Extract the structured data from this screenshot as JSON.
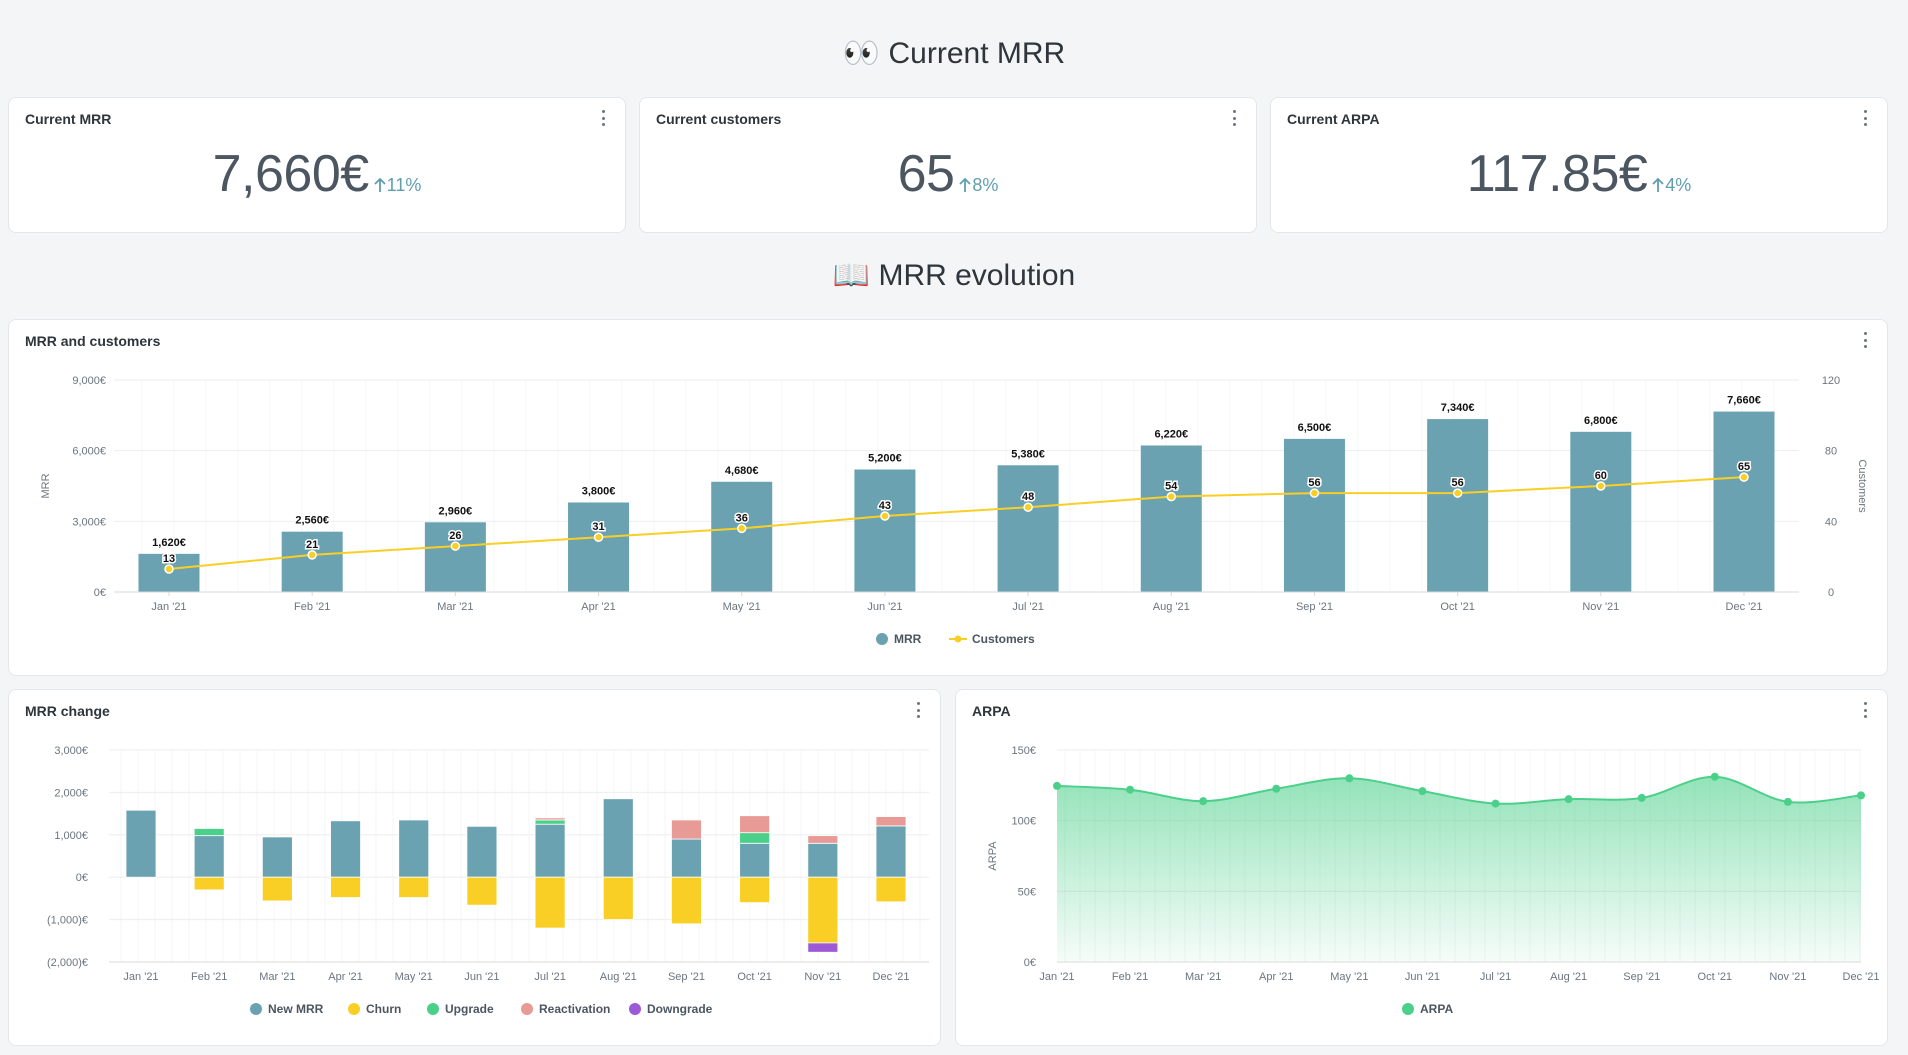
{
  "sections": {
    "current": {
      "icon": "👀",
      "title": "Current MRR"
    },
    "evolution": {
      "icon": "📖",
      "title": "MRR evolution"
    }
  },
  "scalars": [
    {
      "title": "Current MRR",
      "value": "7,660€",
      "change": "11%"
    },
    {
      "title": "Current customers",
      "value": "65",
      "change": "8%"
    },
    {
      "title": "Current ARPA",
      "value": "117.85€",
      "change": "4%"
    }
  ],
  "colors": {
    "mrr": "#6aa2b1",
    "customers": "#f9cf26",
    "new_mrr": "#6aa2b1",
    "churn": "#f9cf26",
    "upgrade": "#4bd08a",
    "reactivation": "#e89a96",
    "downgrade": "#9c5ad6",
    "arpa": "#4bd08a",
    "change_up": "#5f9ead"
  },
  "cards": {
    "mrr_customers": {
      "title": "MRR and customers"
    },
    "mrr_change": {
      "title": "MRR change"
    },
    "arpa": {
      "title": "ARPA"
    }
  },
  "chart_data": [
    {
      "type": "bar",
      "title": "MRR and customers",
      "categories": [
        "Jan '21",
        "Feb '21",
        "Mar '21",
        "Apr '21",
        "May '21",
        "Jun '21",
        "Jul '21",
        "Aug '21",
        "Sep '21",
        "Oct '21",
        "Nov '21",
        "Dec '21"
      ],
      "series": [
        {
          "name": "MRR",
          "type": "bar",
          "axis": "left",
          "values": [
            1620,
            2560,
            2960,
            3800,
            4680,
            5200,
            5380,
            6220,
            6500,
            7340,
            6800,
            7660
          ],
          "labels": [
            "1,620€",
            "2,560€",
            "2,960€",
            "3,800€",
            "4,680€",
            "5,200€",
            "5,380€",
            "6,220€",
            "6,500€",
            "7,340€",
            "6,800€",
            "7,660€"
          ]
        },
        {
          "name": "Customers",
          "type": "line",
          "axis": "right",
          "values": [
            13,
            21,
            26,
            31,
            36,
            43,
            48,
            54,
            56,
            56,
            60,
            65
          ],
          "labels": [
            "13",
            "21",
            "26",
            "31",
            "36",
            "43",
            "48",
            "54",
            "56",
            "56",
            "60",
            "65"
          ]
        }
      ],
      "ylabel": "MRR",
      "y2label": "Customers",
      "ylim": [
        0,
        9000
      ],
      "yticks": [
        "0€",
        "3,000€",
        "6,000€",
        "9,000€"
      ],
      "y2lim": [
        0,
        120
      ],
      "y2ticks": [
        "0",
        "40",
        "80",
        "120"
      ],
      "legend": "bottom"
    },
    {
      "type": "bar",
      "stacked": true,
      "title": "MRR change",
      "categories": [
        "Jan '21",
        "Feb '21",
        "Mar '21",
        "Apr '21",
        "May '21",
        "Jun '21",
        "Jul '21",
        "Aug '21",
        "Sep '21",
        "Oct '21",
        "Nov '21",
        "Dec '21"
      ],
      "series": [
        {
          "name": "New MRR",
          "values": [
            1580,
            980,
            950,
            1330,
            1350,
            1200,
            1250,
            1850,
            900,
            800,
            800,
            1210
          ]
        },
        {
          "name": "Churn",
          "values": [
            0,
            -300,
            -560,
            -480,
            -480,
            -660,
            -1200,
            -1000,
            -1100,
            -600,
            -1550,
            -580
          ]
        },
        {
          "name": "Upgrade",
          "values": [
            0,
            170,
            0,
            0,
            0,
            0,
            100,
            0,
            0,
            250,
            0,
            0
          ]
        },
        {
          "name": "Reactivation",
          "values": [
            0,
            0,
            0,
            0,
            0,
            0,
            50,
            0,
            450,
            400,
            180,
            220
          ]
        },
        {
          "name": "Downgrade",
          "values": [
            0,
            0,
            0,
            0,
            0,
            0,
            0,
            0,
            0,
            0,
            -220,
            0
          ]
        }
      ],
      "ylim": [
        -2000,
        3000
      ],
      "yticks": [
        "(2,000)€",
        "(1,000)€",
        "0€",
        "1,000€",
        "2,000€",
        "3,000€"
      ],
      "legend": "bottom"
    },
    {
      "type": "area",
      "title": "ARPA",
      "categories": [
        "Jan '21",
        "Feb '21",
        "Mar '21",
        "Apr '21",
        "May '21",
        "Jun '21",
        "Jul '21",
        "Aug '21",
        "Sep '21",
        "Oct '21",
        "Nov '21",
        "Dec '21"
      ],
      "series": [
        {
          "name": "ARPA",
          "values": [
            124.6,
            121.9,
            113.8,
            122.6,
            130,
            120.9,
            112.1,
            115.2,
            116.1,
            131.1,
            113.3,
            117.9
          ]
        }
      ],
      "ylabel": "ARPA",
      "ylim": [
        0,
        150
      ],
      "yticks": [
        "0€",
        "50€",
        "100€",
        "150€"
      ],
      "legend": "bottom"
    }
  ]
}
